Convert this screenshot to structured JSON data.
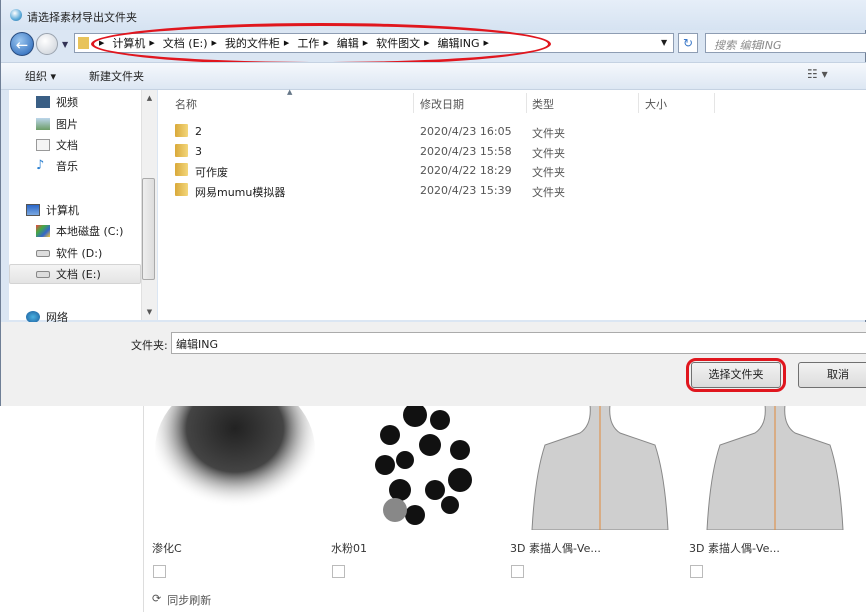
{
  "dialog": {
    "title": "请选择素材导出文件夹",
    "breadcrumbs": [
      "计算机",
      "文档 (E:)",
      "我的文件柜",
      "工作",
      "编辑",
      "软件图文",
      "编辑ING"
    ],
    "search_placeholder": "搜索 编辑ING",
    "toolbar": {
      "organize": "组织 ▾",
      "new_folder": "新建文件夹"
    },
    "nav": [
      {
        "label": "视频",
        "icon": "video-library-icon"
      },
      {
        "label": "图片",
        "icon": "pictures-library-icon"
      },
      {
        "label": "文档",
        "icon": "documents-library-icon"
      },
      {
        "label": "音乐",
        "icon": "music-library-icon"
      },
      {
        "label": "计算机",
        "icon": "computer-icon"
      },
      {
        "label": "本地磁盘 (C:)",
        "icon": "system-drive-icon"
      },
      {
        "label": "软件 (D:)",
        "icon": "drive-icon"
      },
      {
        "label": "文档 (E:)",
        "icon": "drive-icon",
        "selected": true
      },
      {
        "label": "网络",
        "icon": "network-icon"
      }
    ],
    "columns": [
      "名称",
      "修改日期",
      "类型",
      "大小"
    ],
    "files": [
      {
        "name": "2",
        "date": "2020/4/23 16:05",
        "type": "文件夹"
      },
      {
        "name": "3",
        "date": "2020/4/23 15:58",
        "type": "文件夹"
      },
      {
        "name": "可作废",
        "date": "2020/4/22 18:29",
        "type": "文件夹"
      },
      {
        "name": "网易mumu模拟器",
        "date": "2020/4/23 15:39",
        "type": "文件夹"
      }
    ],
    "folder_label": "文件夹:",
    "folder_value": "编辑ING",
    "select_button": "选择文件夹",
    "cancel_button": "取消",
    "annotation_color": "#e0161e"
  },
  "background_app": {
    "items": [
      {
        "label": "渗化C"
      },
      {
        "label": "水粉01"
      },
      {
        "label": "3D 素描人偶-Ve..."
      },
      {
        "label": "3D 素描人偶-Ve..."
      }
    ],
    "sync_refresh": "同步刷新"
  }
}
